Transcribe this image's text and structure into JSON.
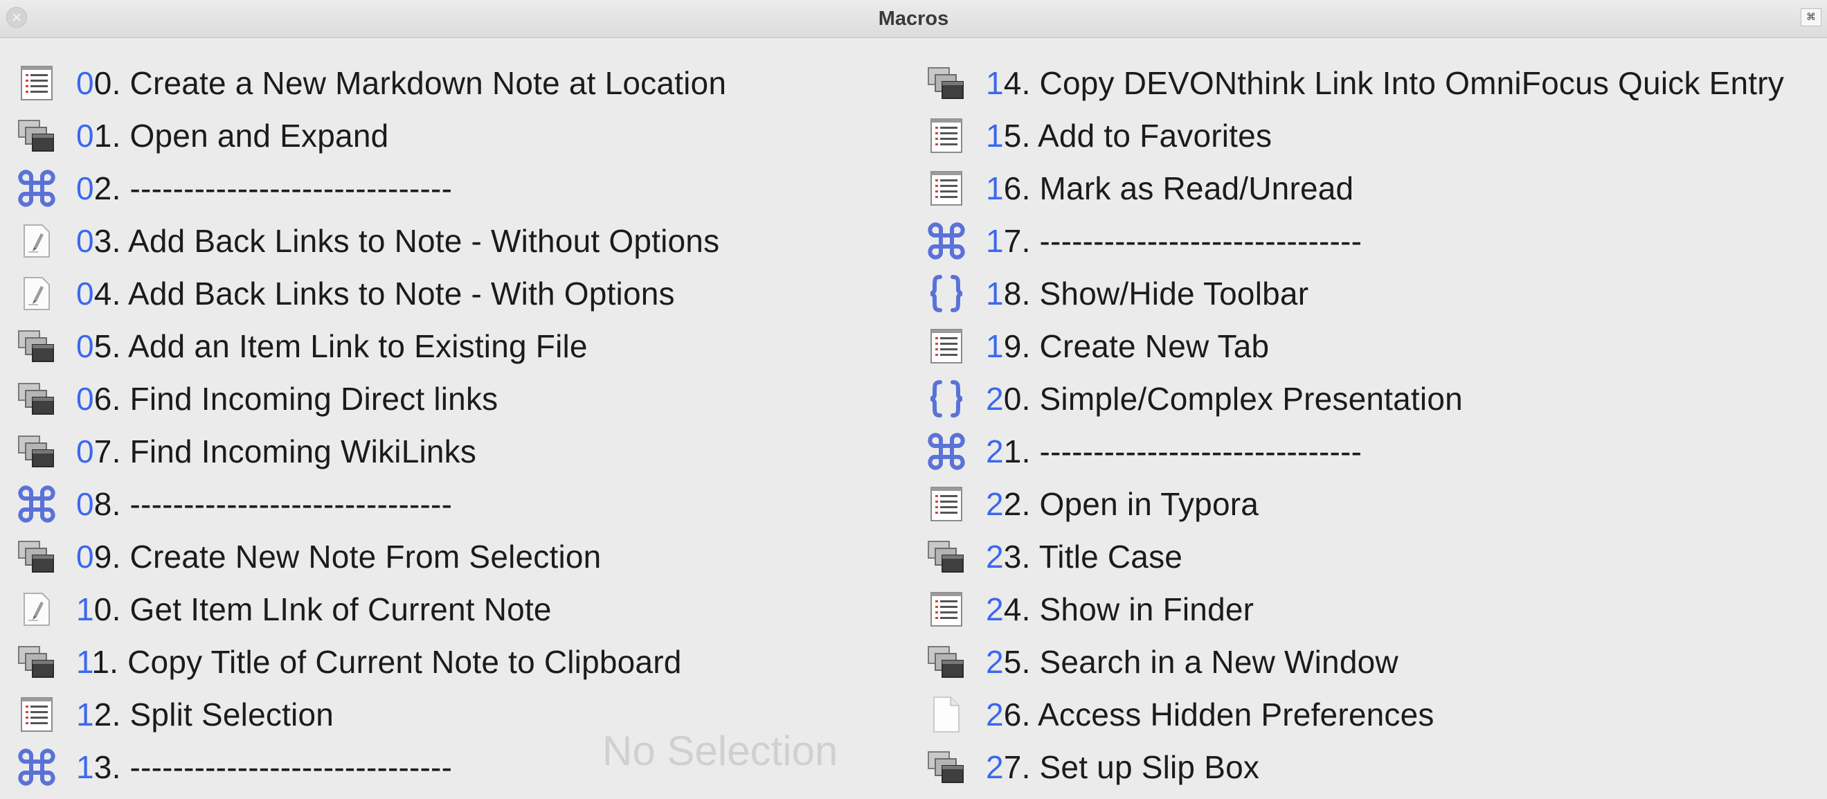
{
  "window": {
    "title": "Macros",
    "corner_icon": "⌘"
  },
  "watermark": "No Selection",
  "columns": [
    [
      {
        "icon": "list-icon",
        "lead": "0",
        "rest": "0. Create a New Markdown Note at Location"
      },
      {
        "icon": "windows-icon",
        "lead": "0",
        "rest": "1. Open and Expand"
      },
      {
        "icon": "command-icon",
        "lead": "0",
        "rest": "2. ------------------------------"
      },
      {
        "icon": "script-icon",
        "lead": "0",
        "rest": "3. Add Back Links to Note - Without Options"
      },
      {
        "icon": "script-icon",
        "lead": "0",
        "rest": "4. Add Back Links to Note - With Options"
      },
      {
        "icon": "windows-icon",
        "lead": "0",
        "rest": "5. Add an Item Link to Existing File"
      },
      {
        "icon": "windows-icon",
        "lead": "0",
        "rest": "6. Find Incoming Direct links"
      },
      {
        "icon": "windows-icon",
        "lead": "0",
        "rest": "7. Find Incoming WikiLinks"
      },
      {
        "icon": "command-icon",
        "lead": "0",
        "rest": "8. ------------------------------"
      },
      {
        "icon": "windows-icon",
        "lead": "0",
        "rest": "9. Create New Note From Selection"
      },
      {
        "icon": "script-icon",
        "lead": "1",
        "rest": "0. Get Item LInk of Current Note"
      },
      {
        "icon": "windows-icon",
        "lead": "1",
        "rest": "1. Copy Title of Current Note to Clipboard"
      },
      {
        "icon": "list-icon",
        "lead": "1",
        "rest": "2. Split Selection"
      },
      {
        "icon": "command-icon",
        "lead": "1",
        "rest": "3. ------------------------------"
      }
    ],
    [
      {
        "icon": "windows-icon",
        "lead": "1",
        "rest": "4. Copy DEVONthink Link Into OmniFocus Quick Entry"
      },
      {
        "icon": "list-icon",
        "lead": "1",
        "rest": "5. Add to Favorites"
      },
      {
        "icon": "list-icon",
        "lead": "1",
        "rest": "6. Mark as Read/Unread"
      },
      {
        "icon": "command-icon",
        "lead": "1",
        "rest": "7. ------------------------------"
      },
      {
        "icon": "braces-icon",
        "lead": "1",
        "rest": "8. Show/Hide Toolbar"
      },
      {
        "icon": "list-icon",
        "lead": "1",
        "rest": "9. Create New Tab"
      },
      {
        "icon": "braces-icon",
        "lead": "2",
        "rest": "0. Simple/Complex Presentation"
      },
      {
        "icon": "command-icon",
        "lead": "2",
        "rest": "1. ------------------------------"
      },
      {
        "icon": "list-icon",
        "lead": "2",
        "rest": "2. Open in Typora"
      },
      {
        "icon": "windows-icon",
        "lead": "2",
        "rest": "3. Title Case"
      },
      {
        "icon": "list-icon",
        "lead": "2",
        "rest": "4. Show in Finder"
      },
      {
        "icon": "windows-icon",
        "lead": "2",
        "rest": "5. Search in a New Window"
      },
      {
        "icon": "document-icon",
        "lead": "2",
        "rest": "6. Access Hidden Preferences"
      },
      {
        "icon": "windows-icon",
        "lead": "2",
        "rest": "7. Set up Slip Box"
      }
    ]
  ],
  "colors": {
    "accent": "#3b68ee",
    "text": "#1b1b1b",
    "background": "#ebebeb"
  }
}
